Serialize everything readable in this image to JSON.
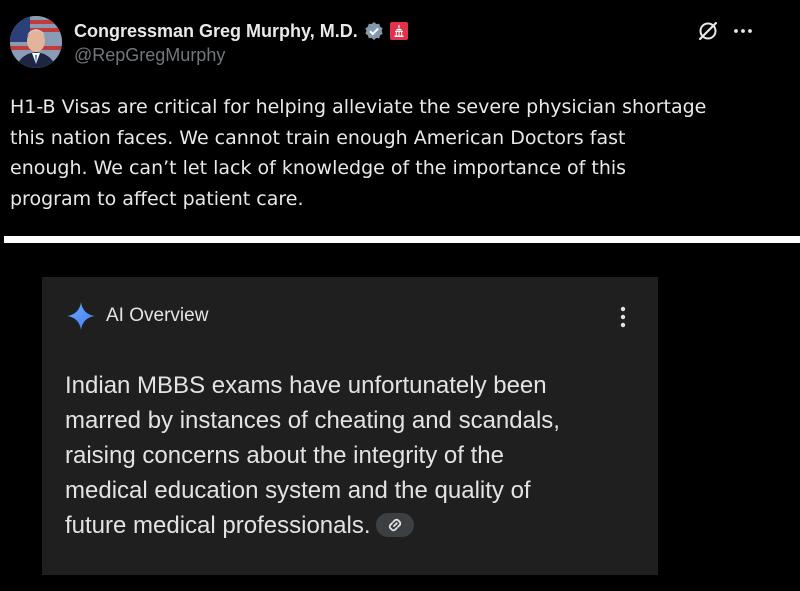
{
  "tweet": {
    "author": {
      "display_name": "Congressman Greg Murphy, M.D.",
      "handle": "@RepGregMurphy"
    },
    "text_lines": [
      "H1-B Visas are critical for helping alleviate the severe physician shortage",
      "this nation faces. We cannot train enough American Doctors fast",
      "enough. We can’t let lack of knowledge of the importance of this",
      "program to affect patient care."
    ],
    "icons": {
      "verified": "verified-badge-icon",
      "affiliation": "government-affiliation-icon",
      "grok": "grok-icon",
      "more": "more-horizontal-icon"
    }
  },
  "ai_overview": {
    "title": "AI Overview",
    "body_lines": [
      "Indian MBBS exams have unfortunately been",
      "marred by instances of cheating and scandals,",
      "raising concerns about the integrity of the",
      "medical education system and the quality of",
      "future medical professionals."
    ],
    "icons": {
      "sparkle": "gemini-sparkle-icon",
      "menu": "kebab-menu-icon",
      "link": "link-icon"
    }
  },
  "colors": {
    "background": "#000000",
    "text_primary": "#e7e9ea",
    "text_secondary": "#71767b",
    "card_background": "#1f1f1f",
    "divider": "#ffffff",
    "affiliation_badge": "#e0334a",
    "sparkle": "#4f8ff7"
  }
}
